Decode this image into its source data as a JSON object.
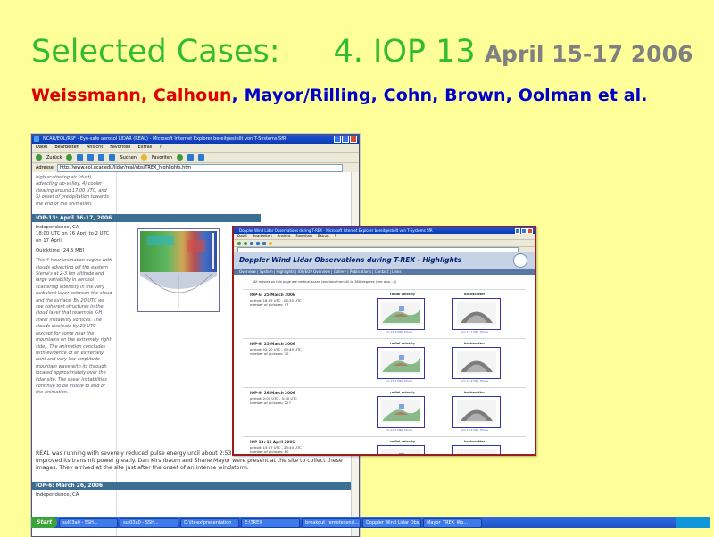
{
  "slide": {
    "title_main": "Selected Cases:",
    "title_case": "4. IOP 13",
    "title_date": "April 15-17 2006",
    "authors": [
      {
        "text": "Weissmann",
        "color": "#e00000"
      },
      {
        "text": "Calhoun",
        "color": "#e00000"
      },
      {
        "text": "Mayor/Rilling",
        "color": "#0000cc"
      },
      {
        "text": "Cohn",
        "color": "#0000cc"
      },
      {
        "text": "Brown",
        "color": "#0000cc"
      },
      {
        "text": "Oolman et al.",
        "color": "#0000cc"
      }
    ],
    "colors": {
      "background": "#ffff99",
      "title": "#33bb33",
      "date": "#808080"
    }
  },
  "ie_main": {
    "title": "NCAR/EOL/RSF - Eye-safe aerosol LIDAR (REAL) - Microsoft Internet Explorer bereitgestellt von T-Systems SfR",
    "menu": [
      "Datei",
      "Bearbeiten",
      "Ansicht",
      "Favoriten",
      "Extras",
      "?"
    ],
    "toolbar": {
      "back": "Zurück",
      "search": "Suchen",
      "favorites": "Favoriten"
    },
    "address_label": "Adresse",
    "address_value": "http://www.eol.ucar.edu/lidar/real/obs/TREX_highlights.htm",
    "prev_text": "high-scattering air (dust) advecting up-valley, 4) cooler clearing around 17:00 UTC, and 5) onset of precipitation towards the end of the animation.",
    "iop13": {
      "header": "IOP-13: April 16-17, 2006",
      "location": "Independence, CA",
      "time": "18:00 UTC on 16 April to 2 UTC on 17 April",
      "quicktime": "Quicktime [24.5 MB]",
      "description": "This 4-hour animation begins with clouds advecting off the eastern Sierra's at 2-3 km altitude and large variability in aerosol scattering intensity in the very turbulent layer between the cloud and the surface. By 20 UTC we see coherent structures in the cloud layer that resemble K-H shear instability vortices. The clouds dissipate by 23 UTC (except for some near the mountains on the extremely right side). The animation concludes with evidence of an extremely faint and very low amplitude mountain wave with its through located approximately over the lidar site. The shear instabilities continue to be visible to end of the animation."
    },
    "note": "REAL was running with severely reduced pulse energy until about 2:53 UTC on 26 March. At about 2:53 UTC we improved its transmit power greatly. Dan Kirshbaum and Shane Mayor were present at the site to collect these images. They arrived at the site just after the onset of an intense windstorm.",
    "iop6": {
      "header": "IOP-6: March 26, 2006",
      "location": "Independence, CA"
    }
  },
  "taskbar": {
    "start": "Start",
    "buttons": [
      "sul03a0 - SSH...",
      "sul03a0 - SSH...",
      "D:\\ltr-ex\\presentation",
      "E:\\TREX",
      "breakout_remotesensi...",
      "Doppler Wind Lidar Obs...",
      "Mayor_TREX_Wo..."
    ]
  },
  "ie_second": {
    "title": "Doppler Wind Lidar Observations during T-REX - Microsoft Internet Explorer bereitgestellt von T-Systems SfR",
    "menu": [
      "Datei",
      "Bearbeiten",
      "Ansicht",
      "Favoriten",
      "Extras",
      "?"
    ],
    "page_title": "Doppler Wind Lidar Observations during T-REX - Highlights",
    "nav": "Overview | System | Highlights | IOP/EOP Overview | Gallery | Publications | Contact | Links",
    "intro": "All movies on this page are vertical scans (sections from 40 to 360 degrees (see also ...))",
    "label_left": "radial velocity",
    "label_right": "backscatter",
    "cases": [
      {
        "title": "IOP-6: 25 March 2006",
        "detail": "period: 18:05 UTC - 00:30 UTC\nnumber of pictures: 47",
        "cap_left": "(xx 22.4 MB), Movie",
        "cap_right": "(xx 21.7 MB), Movie"
      },
      {
        "title": "IOP-6: 25 March 2006",
        "detail": "period: 02:20 UTC - 03:45 UTC\nnumber of pictures: 70",
        "cap_left": "(xx 15.4 MB), Movie",
        "cap_right": "(xx 15.4 MB), Movie"
      },
      {
        "title": "IOP-9: 26 March 2006",
        "detail": "period: 2:05 UTC - 5:40 UTC\nnumber of pictures: 227",
        "cap_left": "(xx 21.3 MB), Movie",
        "cap_right": "(xx 18.4 MB), Movie"
      },
      {
        "title": "IOP 13: 15 April 2006",
        "detail": "period: 15:07 UTC - 23:40 UTC\nnumber of pictures: 80",
        "cap_left": "",
        "cap_right": ""
      }
    ]
  }
}
